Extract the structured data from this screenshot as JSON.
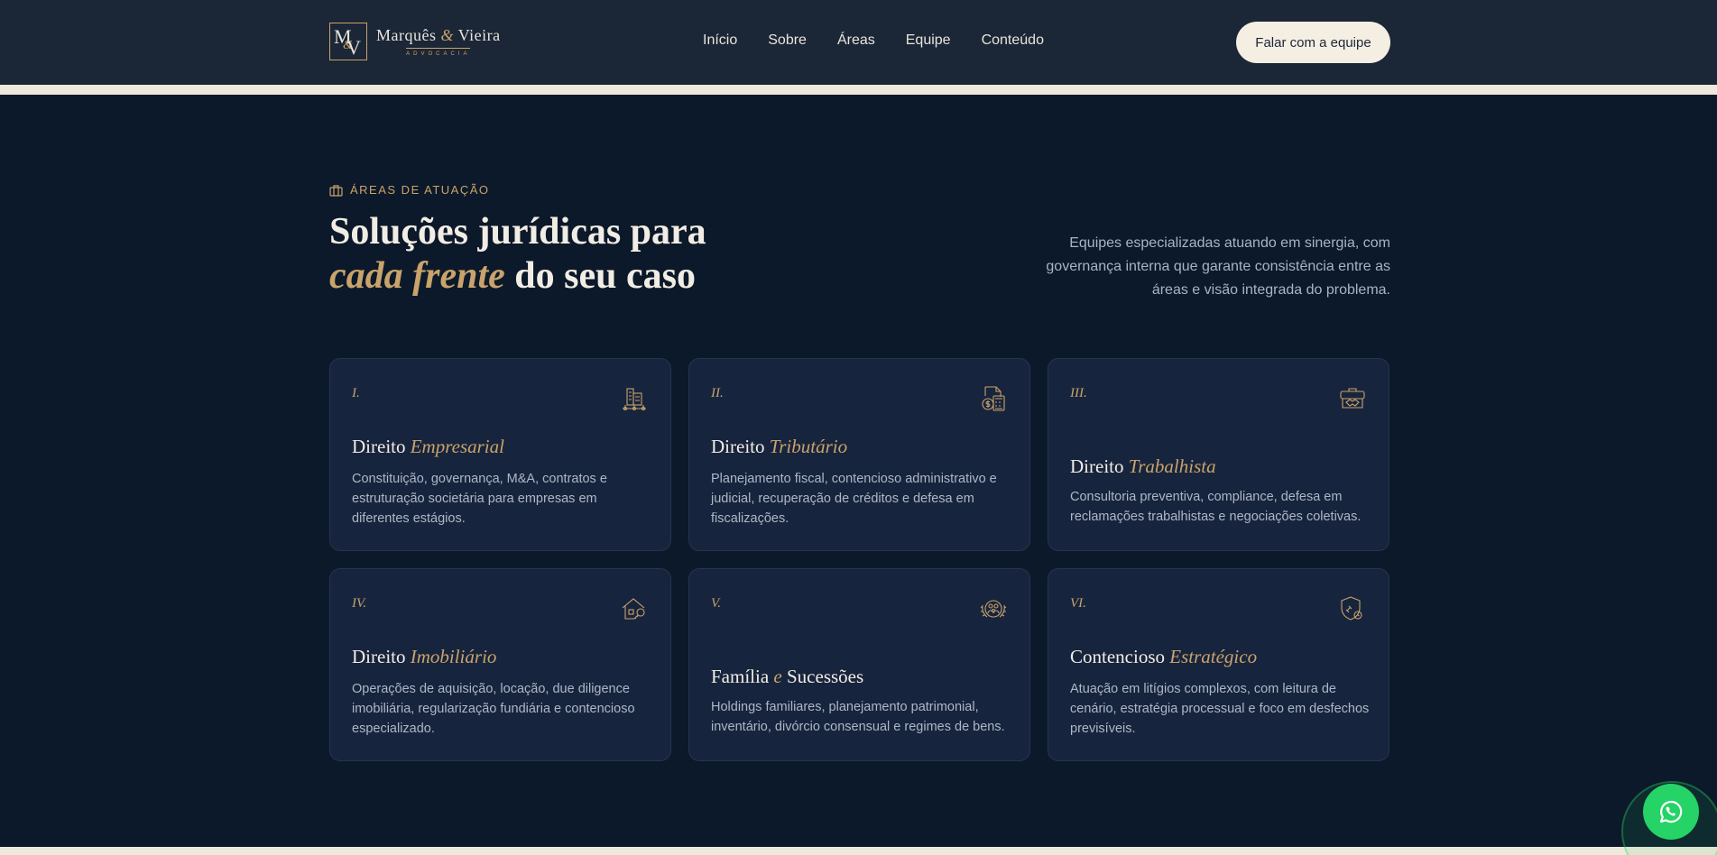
{
  "header": {
    "logo": {
      "name_left": "Marquês",
      "name_amp": "&",
      "name_right": "Vieira",
      "subtitle": "ADVOCACIA"
    },
    "nav": [
      "Início",
      "Sobre",
      "Áreas",
      "Equipe",
      "Conteúdo"
    ],
    "cta_label": "Falar com a equipe"
  },
  "section": {
    "eyebrow": "ÁREAS DE ATUAÇÃO",
    "headline_line1": "Soluções jurídicas para",
    "headline_highlight": "cada frente",
    "headline_rest": " do seu caso",
    "intro": "Equipes especializadas atuando em sinergia, com governança interna que garante consistência entre as áreas e visão integrada do problema."
  },
  "cards": [
    {
      "num": "I.",
      "title_a": "Direito ",
      "title_b": "Empresarial",
      "title_c": "",
      "icon": "building-network-icon",
      "desc": "Constituição, governança, M&A, contratos e estruturação societária para empresas em diferentes estágios."
    },
    {
      "num": "II.",
      "title_a": "Direito ",
      "title_b": "Tributário",
      "title_c": "",
      "icon": "tax-document-icon",
      "desc": "Planejamento fiscal, contencioso administrativo e judicial, recuperação de créditos e defesa em fiscalizações."
    },
    {
      "num": "III.",
      "title_a": "Direito ",
      "title_b": "Trabalhista",
      "title_c": "",
      "icon": "briefcase-handshake-icon",
      "desc": "Consultoria preventiva, compliance, defesa em reclamações trabalhistas e negociações coletivas."
    },
    {
      "num": "IV.",
      "title_a": "Direito ",
      "title_b": "Imobiliário",
      "title_c": "",
      "icon": "house-key-icon",
      "desc": "Operações de aquisição, locação, due diligence imobiliária, regularização fundiária e contencioso especializado."
    },
    {
      "num": "V.",
      "title_a": "Família ",
      "title_b": "e",
      "title_c": " Sucessões",
      "icon": "family-tree-icon",
      "desc": "Holdings familiares, planejamento patrimonial, inventário, divórcio consensual e regimes de bens."
    },
    {
      "num": "VI.",
      "title_a": "Contencioso ",
      "title_b": "Estratégico",
      "title_c": "",
      "icon": "shield-gavel-icon",
      "desc": "Atuação em litígios complexos, com leitura de cenário, estratégia processual e foco em desfechos previsíveis."
    }
  ],
  "colors": {
    "accent_gold": "#c9a36b",
    "navy": "#0c192a",
    "card_bg": "#17243d",
    "cream": "#f5eee3",
    "whatsapp_green": "#25d366"
  }
}
